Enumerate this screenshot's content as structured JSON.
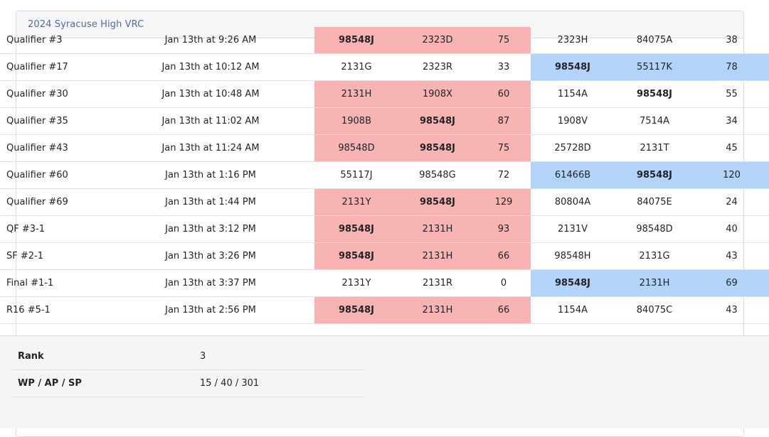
{
  "event": {
    "title": "2024 Syracuse High VRC"
  },
  "team": "98548J",
  "matches": [
    {
      "name": "Qualifier #3",
      "time": "Jan 13th at 9:26 AM",
      "red": [
        "98548J",
        "2323D"
      ],
      "red_score": "75",
      "blue": [
        "2323H",
        "84075A"
      ],
      "blue_score": "38",
      "team_alliance": "red"
    },
    {
      "name": "Qualifier #17",
      "time": "Jan 13th at 10:12 AM",
      "red": [
        "2131G",
        "2323R"
      ],
      "red_score": "33",
      "blue": [
        "98548J",
        "55117K"
      ],
      "blue_score": "78",
      "team_alliance": "blue"
    },
    {
      "name": "Qualifier #30",
      "time": "Jan 13th at 10:48 AM",
      "red": [
        "2131H",
        "1908X"
      ],
      "red_score": "60",
      "blue": [
        "1154A",
        "98548J"
      ],
      "blue_score": "55",
      "team_alliance": "red"
    },
    {
      "name": "Qualifier #35",
      "time": "Jan 13th at 11:02 AM",
      "red": [
        "1908B",
        "98548J"
      ],
      "red_score": "87",
      "blue": [
        "1908V",
        "7514A"
      ],
      "blue_score": "34",
      "team_alliance": "red"
    },
    {
      "name": "Qualifier #43",
      "time": "Jan 13th at 11:24 AM",
      "red": [
        "98548D",
        "98548J"
      ],
      "red_score": "75",
      "blue": [
        "25728D",
        "2131T"
      ],
      "blue_score": "45",
      "team_alliance": "red"
    },
    {
      "name": "Qualifier #60",
      "time": "Jan 13th at 1:16 PM",
      "red": [
        "55117J",
        "98548G"
      ],
      "red_score": "72",
      "blue": [
        "61466B",
        "98548J"
      ],
      "blue_score": "120",
      "team_alliance": "blue"
    },
    {
      "name": "Qualifier #69",
      "time": "Jan 13th at 1:44 PM",
      "red": [
        "2131Y",
        "98548J"
      ],
      "red_score": "129",
      "blue": [
        "80804A",
        "84075E"
      ],
      "blue_score": "24",
      "team_alliance": "red"
    },
    {
      "name": "QF #3-1",
      "time": "Jan 13th at 3:12 PM",
      "red": [
        "98548J",
        "2131H"
      ],
      "red_score": "93",
      "blue": [
        "2131V",
        "98548D"
      ],
      "blue_score": "40",
      "team_alliance": "red"
    },
    {
      "name": "SF #2-1",
      "time": "Jan 13th at 3:26 PM",
      "red": [
        "98548J",
        "2131H"
      ],
      "red_score": "66",
      "blue": [
        "98548H",
        "2131G"
      ],
      "blue_score": "43",
      "team_alliance": "red"
    },
    {
      "name": "Final #1-1",
      "time": "Jan 13th at 3:37 PM",
      "red": [
        "2131Y",
        "2131R"
      ],
      "red_score": "0",
      "blue": [
        "98548J",
        "2131H"
      ],
      "blue_score": "69",
      "team_alliance": "blue"
    },
    {
      "name": "R16 #5-1",
      "time": "Jan 13th at 2:56 PM",
      "red": [
        "98548J",
        "2131H"
      ],
      "red_score": "66",
      "blue": [
        "1154A",
        "84075C"
      ],
      "blue_score": "43",
      "team_alliance": "red"
    }
  ],
  "stats": [
    {
      "label": "Rank",
      "value": "3"
    },
    {
      "label": "WP / AP / SP",
      "value": "15 / 40 / 301"
    }
  ],
  "colors": {
    "red_highlight": "#f8b3b3",
    "blue_highlight": "#b3d3f8",
    "link": "#4a6fa5"
  }
}
